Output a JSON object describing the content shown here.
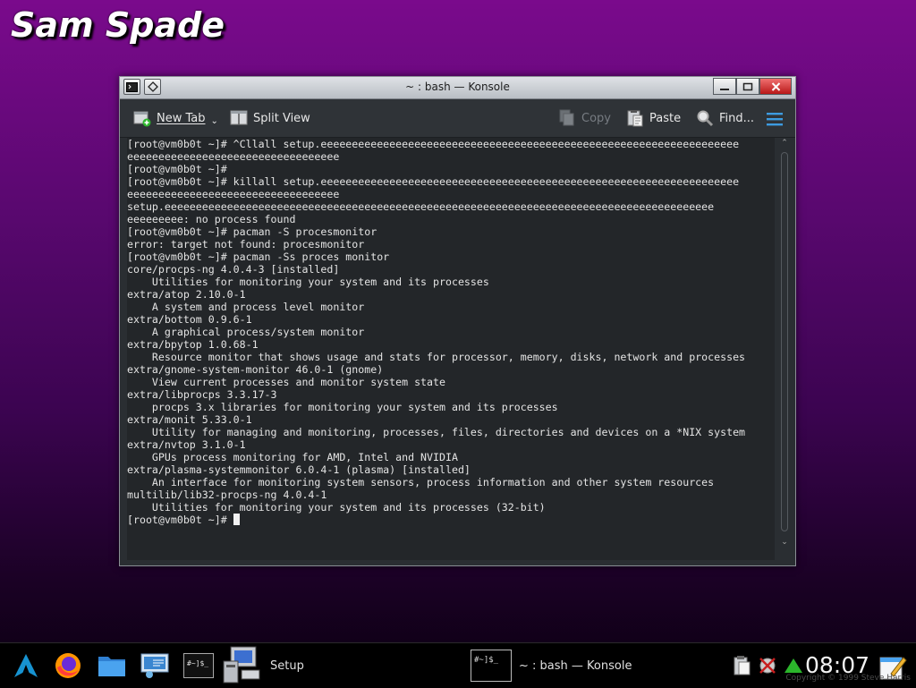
{
  "desktop": {
    "title": "Sam Spade"
  },
  "window": {
    "title": "~ : bash — Konsole",
    "titlebar_left_icons": [
      "terminal-icon",
      "pin-icon"
    ],
    "buttons": {
      "minimize": "▁",
      "maximize": "▢",
      "close": "✕"
    }
  },
  "toolbar": {
    "new_tab": "New Tab",
    "split_view": "Split View",
    "copy": "Copy",
    "paste": "Paste",
    "find": "Find...",
    "menu_icon": "hamburger-menu-icon"
  },
  "terminal": {
    "lines": [
      "[root@vm0b0t ~]# ^Cllall setup.eeeeeeeeeeeeeeeeeeeeeeeeeeeeeeeeeeeeeeeeeeeeeeeeeeeeeeeeeeeeeeeeeee",
      "eeeeeeeeeeeeeeeeeeeeeeeeeeeeeeeeee",
      "[root@vm0b0t ~]#",
      "[root@vm0b0t ~]# killall setup.eeeeeeeeeeeeeeeeeeeeeeeeeeeeeeeeeeeeeeeeeeeeeeeeeeeeeeeeeeeeeeeeeee",
      "eeeeeeeeeeeeeeeeeeeeeeeeeeeeeeeeee",
      "setup.eeeeeeeeeeeeeeeeeeeeeeeeeeeeeeeeeeeeeeeeeeeeeeeeeeeeeeeeeeeeeeeeeeeeeeeeeeeeeeeeeeeeeeee",
      "eeeeeeeee: no process found",
      "[root@vm0b0t ~]# pacman -S procesmonitor",
      "error: target not found: procesmonitor",
      "[root@vm0b0t ~]# pacman -Ss proces monitor",
      "core/procps-ng 4.0.4-3 [installed]",
      "    Utilities for monitoring your system and its processes",
      "extra/atop 2.10.0-1",
      "    A system and process level monitor",
      "extra/bottom 0.9.6-1",
      "    A graphical process/system monitor",
      "extra/bpytop 1.0.68-1",
      "    Resource monitor that shows usage and stats for processor, memory, disks, network and processes",
      "extra/gnome-system-monitor 46.0-1 (gnome)",
      "    View current processes and monitor system state",
      "extra/libprocps 3.3.17-3",
      "    procps 3.x libraries for monitoring your system and its processes",
      "extra/monit 5.33.0-1",
      "    Utility for managing and monitoring, processes, files, directories and devices on a *NIX system",
      "extra/nvtop 3.1.0-1",
      "    GPUs process monitoring for AMD, Intel and NVIDIA",
      "extra/plasma-systemmonitor 6.0.4-1 (plasma) [installed]",
      "    An interface for monitoring system sensors, process information and other system resources",
      "multilib/lib32-procps-ng 4.0.4-1",
      "    Utilities for monitoring your system and its processes (32-bit)"
    ],
    "prompt": "[root@vm0b0t ~]# "
  },
  "taskbar": {
    "launchers": [
      "arch-linux-icon",
      "firefox-icon",
      "folder-icon",
      "system-settings-icon",
      "terminal-icon"
    ],
    "setup_task": "Setup",
    "konsole_task_icon_text": "#~]$_",
    "konsole_task": "~ : bash — Konsole",
    "clock": "08:07",
    "copyright": "Copyright © 1999 Steve Harris"
  }
}
